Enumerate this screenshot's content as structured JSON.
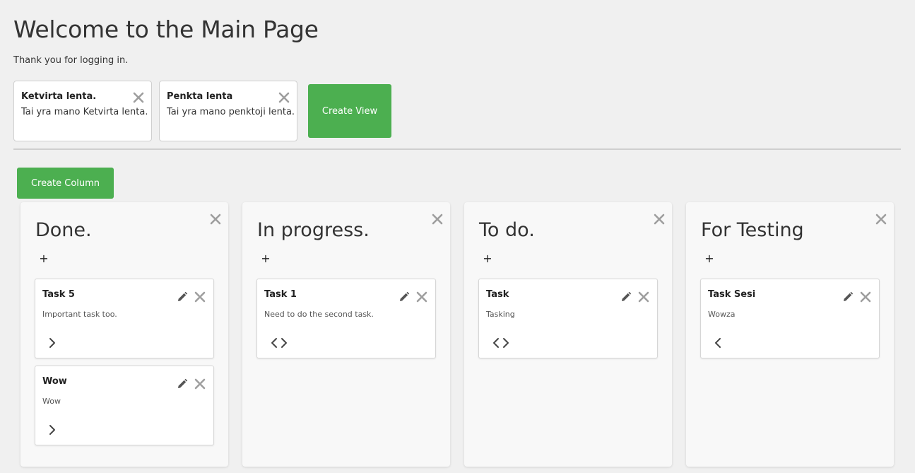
{
  "header": {
    "title": "Welcome to the Main Page",
    "subtitle": "Thank you for logging in."
  },
  "views": [
    {
      "title": "Ketvirta lenta.",
      "description": "Tai yra mano Ketvirta lenta.",
      "close_icon": "close-icon"
    },
    {
      "title": "Penkta lenta",
      "description": "Tai yra mano penktoji lenta.",
      "close_icon": "close-icon"
    }
  ],
  "actions": {
    "create_view_label": "Create View",
    "create_column_label": "Create Column"
  },
  "columns": [
    {
      "title": "Done.",
      "add_label": "+",
      "tasks": [
        {
          "title": "Task 5",
          "description": "Important task too.",
          "nav": [
            "next"
          ]
        },
        {
          "title": "Wow",
          "description": "Wow",
          "nav": [
            "next"
          ]
        }
      ]
    },
    {
      "title": "In progress.",
      "add_label": "+",
      "tasks": [
        {
          "title": "Task 1",
          "description": "Need to do the second task.",
          "nav": [
            "prev",
            "next"
          ]
        }
      ]
    },
    {
      "title": "To do.",
      "add_label": "+",
      "tasks": [
        {
          "title": "Task",
          "description": "Tasking",
          "nav": [
            "prev",
            "next"
          ]
        }
      ]
    },
    {
      "title": "For Testing",
      "add_label": "+",
      "tasks": [
        {
          "title": "Task Sesi",
          "description": "Wowza",
          "nav": [
            "prev"
          ]
        }
      ]
    }
  ],
  "colors": {
    "accent_green": "#4caf50",
    "page_background": "#f0f0f0",
    "icon_gray": "#9e9e9e",
    "edit_icon": "#555555"
  }
}
